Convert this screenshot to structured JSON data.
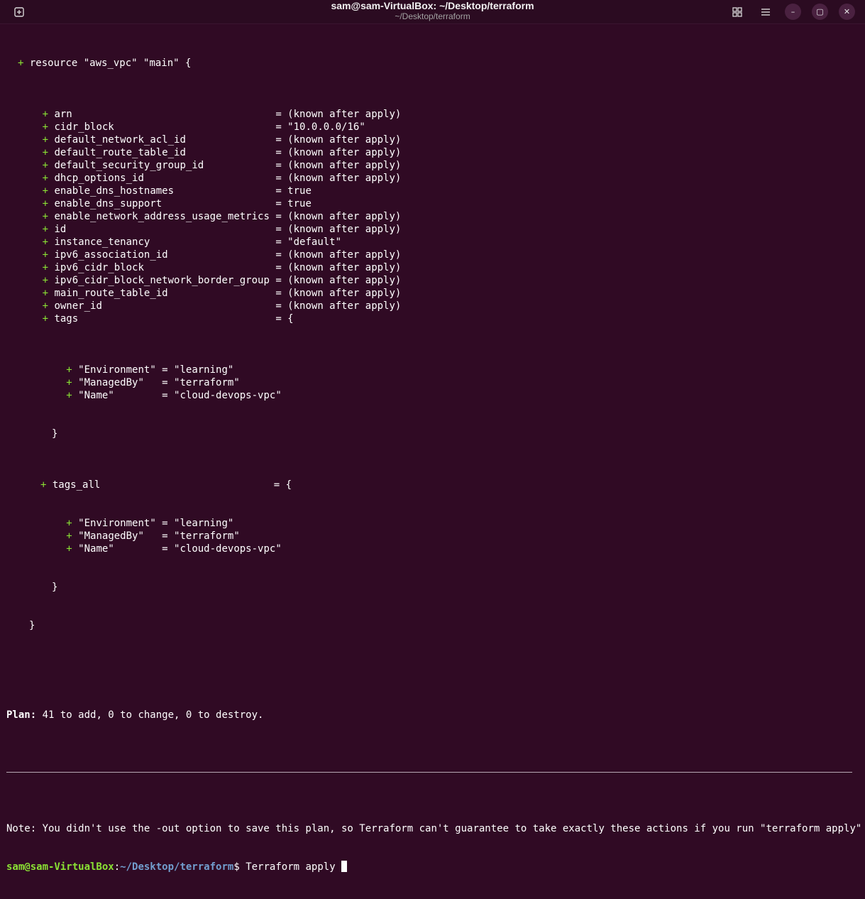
{
  "window": {
    "title": "sam@sam-VirtualBox: ~/Desktop/terraform",
    "subtitle": "~/Desktop/terraform",
    "new_tab_icon": "new-tab-icon",
    "grid_icon": "grid-view-icon",
    "menu_icon": "hamburger-menu-icon",
    "minimize_label": "–",
    "maximize_label": "▢",
    "close_label": "✕"
  },
  "terminal": {
    "resource_line": "resource \"aws_vpc\" \"main\" {",
    "attributes": [
      {
        "name": "arn",
        "value": "= (known after apply)"
      },
      {
        "name": "cidr_block",
        "value": "= \"10.0.0.0/16\""
      },
      {
        "name": "default_network_acl_id",
        "value": "= (known after apply)"
      },
      {
        "name": "default_route_table_id",
        "value": "= (known after apply)"
      },
      {
        "name": "default_security_group_id",
        "value": "= (known after apply)"
      },
      {
        "name": "dhcp_options_id",
        "value": "= (known after apply)"
      },
      {
        "name": "enable_dns_hostnames",
        "value": "= true"
      },
      {
        "name": "enable_dns_support",
        "value": "= true"
      },
      {
        "name": "enable_network_address_usage_metrics",
        "value": "= (known after apply)"
      },
      {
        "name": "id",
        "value": "= (known after apply)"
      },
      {
        "name": "instance_tenancy",
        "value": "= \"default\""
      },
      {
        "name": "ipv6_association_id",
        "value": "= (known after apply)"
      },
      {
        "name": "ipv6_cidr_block",
        "value": "= (known after apply)"
      },
      {
        "name": "ipv6_cidr_block_network_border_group",
        "value": "= (known after apply)"
      },
      {
        "name": "main_route_table_id",
        "value": "= (known after apply)"
      },
      {
        "name": "owner_id",
        "value": "= (known after apply)"
      },
      {
        "name": "tags",
        "value": "= {"
      }
    ],
    "tags": [
      "\"Environment\" = \"learning\"",
      "\"ManagedBy\"   = \"terraform\"",
      "\"Name\"        = \"cloud-devops-vpc\""
    ],
    "tags_all_name": "tags_all",
    "tags_all_value": "= {",
    "tags_all": [
      "\"Environment\" = \"learning\"",
      "\"ManagedBy\"   = \"terraform\"",
      "\"Name\"        = \"cloud-devops-vpc\""
    ],
    "close_brace": "}",
    "plan_label": "Plan:",
    "plan_text": " 41 to add, 0 to change, 0 to destroy.",
    "note": "Note: You didn't use the -out option to save this plan, so Terraform can't guarantee to take exactly these actions if you run \"terraform apply\" now.",
    "prompt_user": "sam@sam-VirtualBox",
    "prompt_sep": ":",
    "prompt_path": "~/Desktop/terraform",
    "prompt_symbol": "$",
    "command": "Terraform apply"
  },
  "colors": {
    "background": "#300a24",
    "plus": "#8ae234",
    "prompt_user": "#8ae234",
    "prompt_path": "#729fcf"
  }
}
